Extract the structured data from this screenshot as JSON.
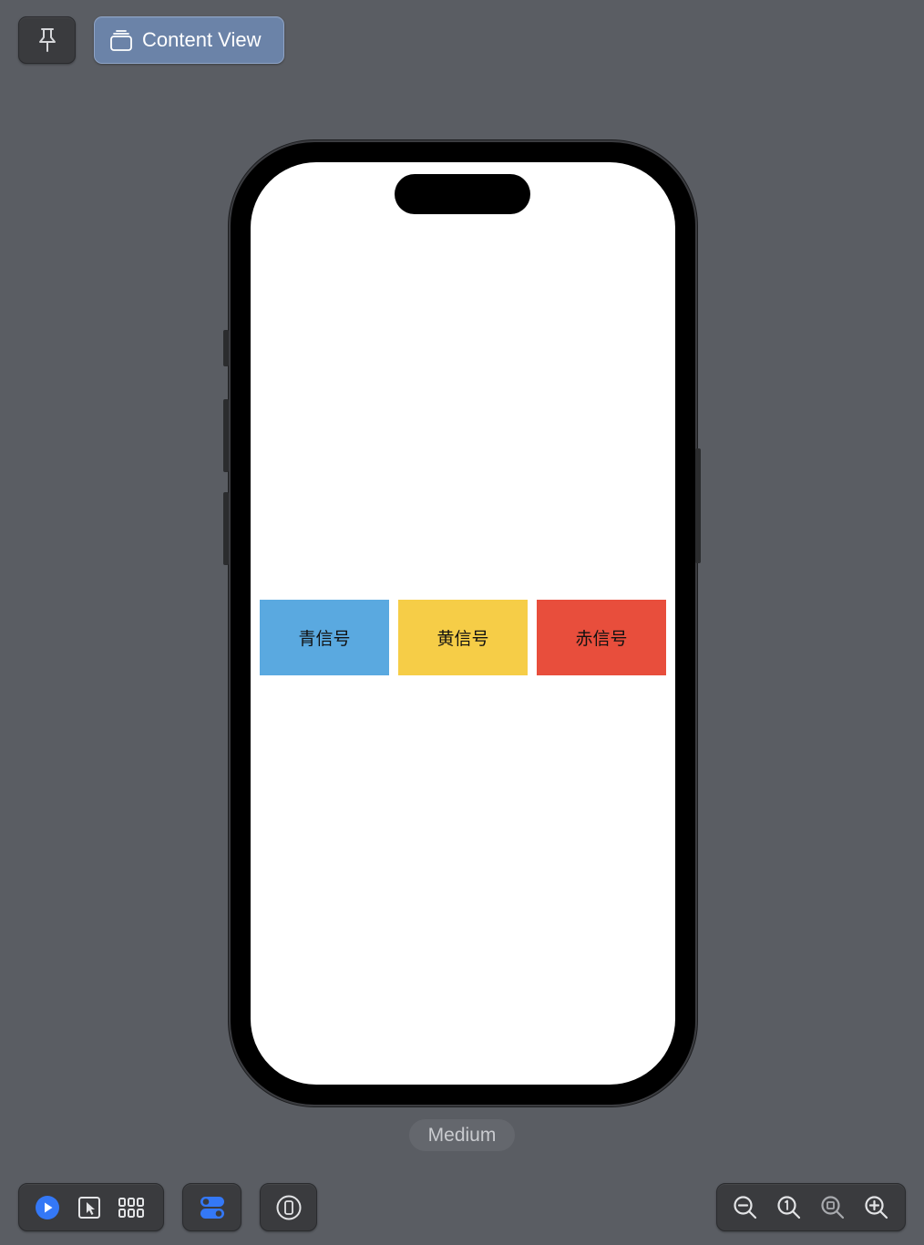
{
  "toolbar": {
    "pin_icon": "pin-icon",
    "content_view_label": "Content View",
    "content_view_icon": "stack-icon"
  },
  "preview": {
    "signals": [
      {
        "label": "青信号",
        "color": "#5aa9e0"
      },
      {
        "label": "黄信号",
        "color": "#f6cd47"
      },
      {
        "label": "赤信号",
        "color": "#e84e3c"
      }
    ],
    "variant_label": "Medium"
  },
  "bottom_bar": {
    "modes": [
      "live-play-icon",
      "selectable-cursor-icon",
      "grid-variants-icon"
    ],
    "variants_icon": "toggle-icon",
    "device_icon": "device-settings-icon",
    "zoom": [
      "zoom-out-icon",
      "zoom-actual-size-icon",
      "zoom-to-fit-icon",
      "zoom-in-icon"
    ]
  },
  "colors": {
    "canvas": "#5a5d63",
    "accent": "#3478f6",
    "content_view_bg": "#6b83a8"
  }
}
